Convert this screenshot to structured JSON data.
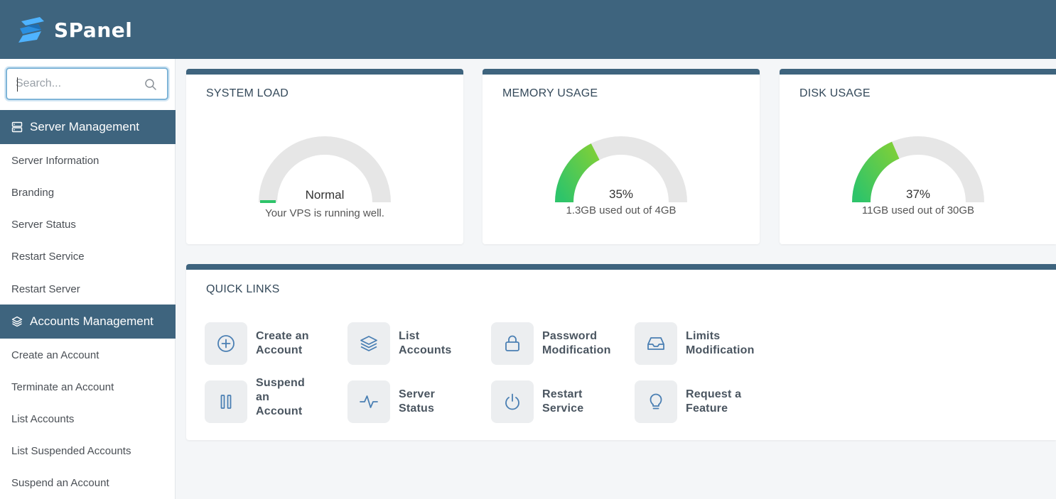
{
  "header": {
    "brand": "SPanel",
    "logo_icon": "spanel-logo-icon",
    "bg_color": "#3e647e"
  },
  "sidebar": {
    "search_placeholder": "Search...",
    "sections": [
      {
        "label": "Server Management",
        "icon": "server-icon",
        "items": [
          "Server Information",
          "Branding",
          "Server Status",
          "Restart Service",
          "Restart Server"
        ]
      },
      {
        "label": "Accounts Management",
        "icon": "layers-icon",
        "items": [
          "Create an Account",
          "Terminate an Account",
          "List Accounts",
          "List Suspended Accounts",
          "Suspend an Account"
        ]
      }
    ]
  },
  "stats": {
    "system_load": {
      "title": "SYSTEM LOAD",
      "value": "Normal",
      "subtitle": "Your VPS is running well.",
      "fraction": 0.02
    },
    "memory": {
      "title": "MEMORY USAGE",
      "value": "35%",
      "subtitle": "1.3GB used out of 4GB",
      "fraction": 0.35
    },
    "disk": {
      "title": "DISK USAGE",
      "value": "37%",
      "subtitle": "11GB used out of 30GB",
      "fraction": 0.37
    }
  },
  "quick_links": {
    "title": "QUICK LINKS",
    "items": [
      {
        "line1": "Create an",
        "line2": "Account",
        "line3": "",
        "icon": "plus-circle-icon"
      },
      {
        "line1": "List",
        "line2": "Accounts",
        "line3": "",
        "icon": "layers-icon"
      },
      {
        "line1": "Password",
        "line2": "Modification",
        "line3": "",
        "icon": "lock-icon"
      },
      {
        "line1": "Limits",
        "line2": "Modification",
        "line3": "",
        "icon": "inbox-icon"
      },
      {
        "line1": "Suspend",
        "line2": "an",
        "line3": "Account",
        "icon": "pause-icon"
      },
      {
        "line1": "Server",
        "line2": "Status",
        "line3": "",
        "icon": "activity-icon"
      },
      {
        "line1": "Restart",
        "line2": "Service",
        "line3": "",
        "icon": "power-icon"
      },
      {
        "line1": "Request a",
        "line2": "Feature",
        "line3": "",
        "icon": "lightbulb-icon"
      }
    ]
  },
  "colors": {
    "accent": "#3e647e",
    "gauge_track": "#e6e6e6",
    "gauge_green_start": "#2ec46a",
    "gauge_green_end": "#7ccf3a"
  }
}
